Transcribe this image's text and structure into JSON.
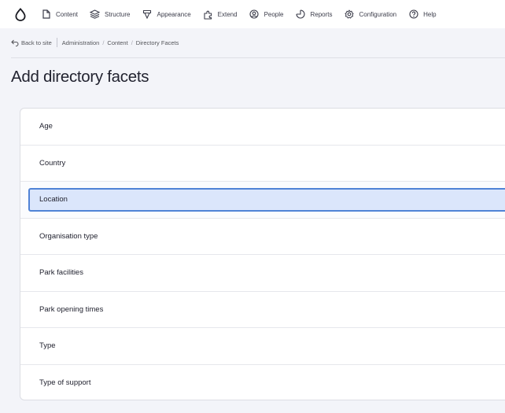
{
  "toolbar": {
    "items": [
      {
        "label": "Content",
        "icon": "content-icon"
      },
      {
        "label": "Structure",
        "icon": "structure-icon"
      },
      {
        "label": "Appearance",
        "icon": "appearance-icon"
      },
      {
        "label": "Extend",
        "icon": "extend-icon"
      },
      {
        "label": "People",
        "icon": "people-icon"
      },
      {
        "label": "Reports",
        "icon": "reports-icon"
      },
      {
        "label": "Configuration",
        "icon": "configuration-icon"
      },
      {
        "label": "Help",
        "icon": "help-icon"
      }
    ]
  },
  "breadcrumb": {
    "back_label": "Back to site",
    "items": [
      "Administration",
      "Content",
      "Directory Facets"
    ]
  },
  "page": {
    "title": "Add directory facets"
  },
  "facets": {
    "items": [
      {
        "label": "Age"
      },
      {
        "label": "Country"
      },
      {
        "label": "Location"
      },
      {
        "label": "Organisation type"
      },
      {
        "label": "Park facilities"
      },
      {
        "label": "Park opening times"
      },
      {
        "label": "Type"
      },
      {
        "label": "Type of support"
      }
    ],
    "selected_label": "Location"
  },
  "colors": {
    "accent": "#5083d6",
    "selected_fill": "#dbe6fb",
    "background": "#f3f4f9"
  }
}
